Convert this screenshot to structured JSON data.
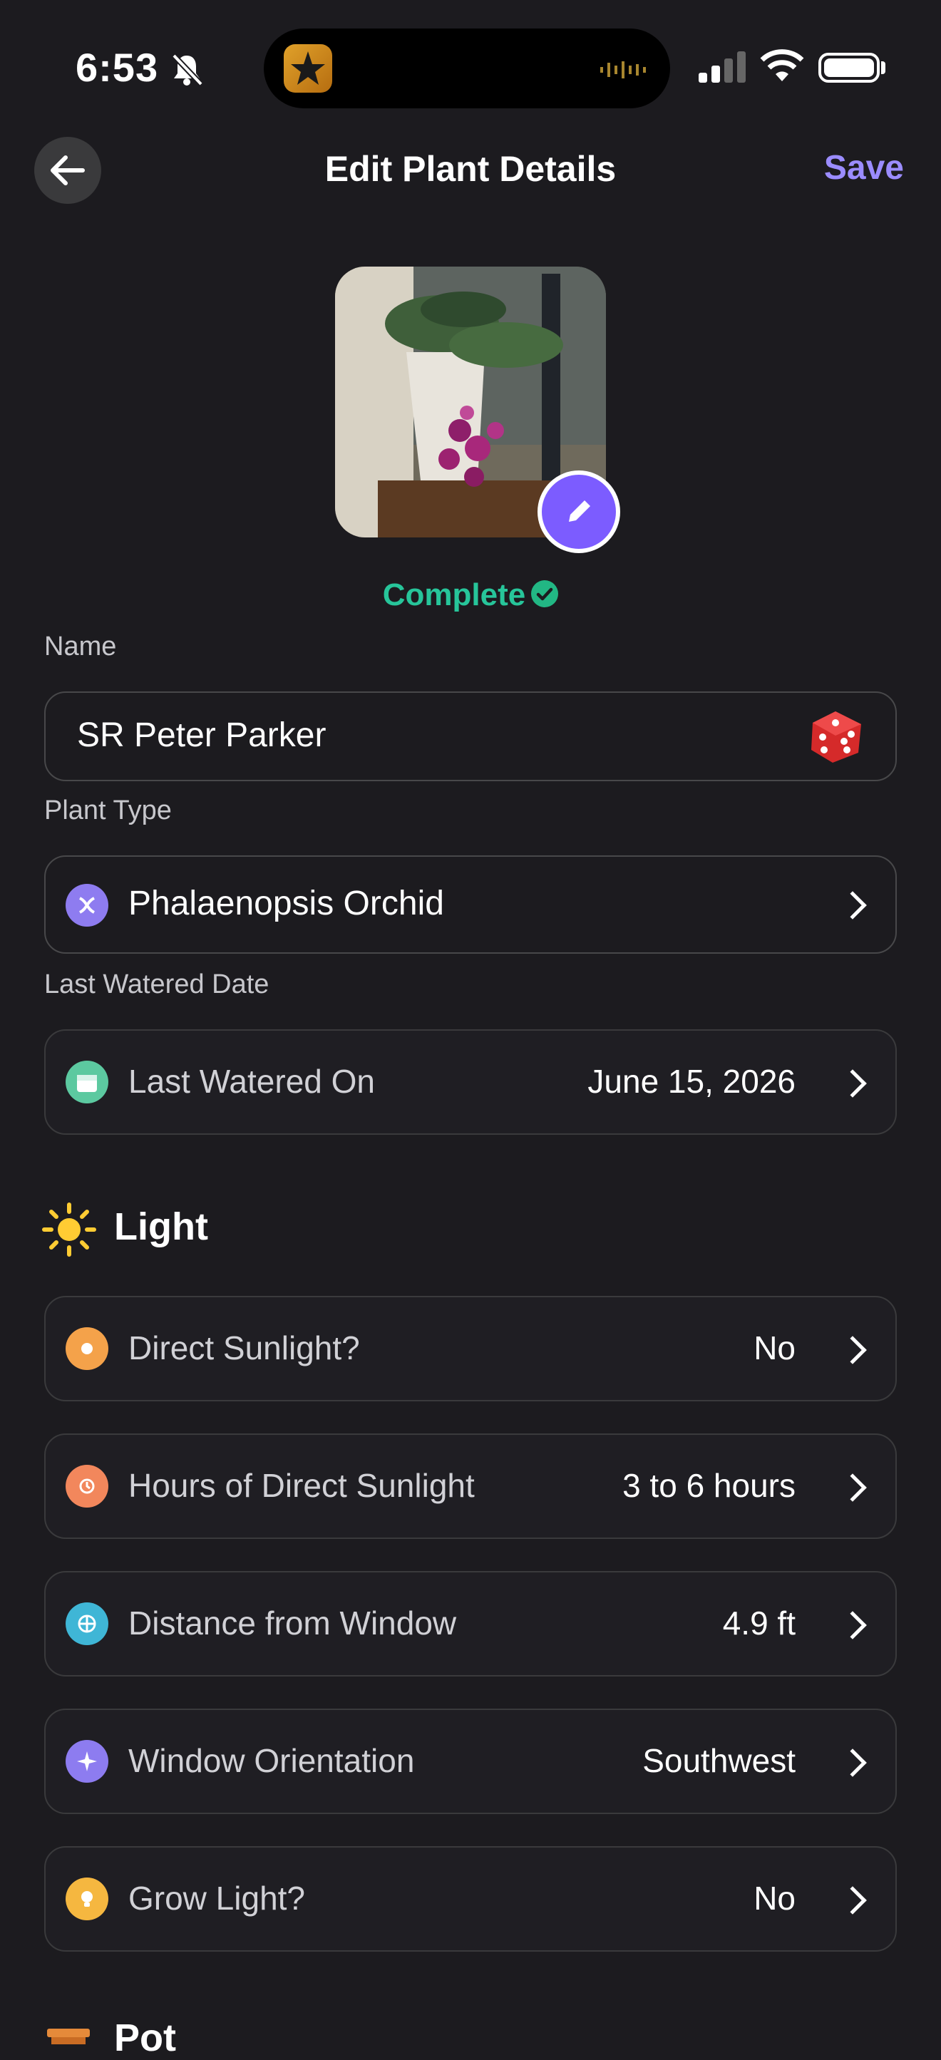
{
  "status_bar": {
    "time": "6:53"
  },
  "header": {
    "title": "Edit Plant Details",
    "save_label": "Save"
  },
  "photo": {
    "status": "Complete"
  },
  "name_section": {
    "label": "Name",
    "value": "SR Peter Parker"
  },
  "plant_type_section": {
    "label": "Plant Type",
    "value": "Phalaenopsis Orchid"
  },
  "watered_section": {
    "label": "Last Watered Date",
    "row_label": "Last Watered On",
    "row_value": "June 15, 2026"
  },
  "light_section": {
    "title": "Light",
    "rows": [
      {
        "label": "Direct Sunlight?",
        "value": "No",
        "icon": "sun-circle-icon"
      },
      {
        "label": "Hours of Direct Sunlight",
        "value": "3 to 6 hours",
        "icon": "sun-clock-icon"
      },
      {
        "label": "Distance from Window",
        "value": "4.9 ft",
        "icon": "window-icon"
      },
      {
        "label": "Window Orientation",
        "value": "Southwest",
        "icon": "compass-icon"
      },
      {
        "label": "Grow Light?",
        "value": "No",
        "icon": "bulb-icon"
      }
    ]
  },
  "next_section": {
    "title": "Pot"
  },
  "colors": {
    "accent": "#9b8cff",
    "success": "#27c59a",
    "background": "#1c1b1f"
  }
}
